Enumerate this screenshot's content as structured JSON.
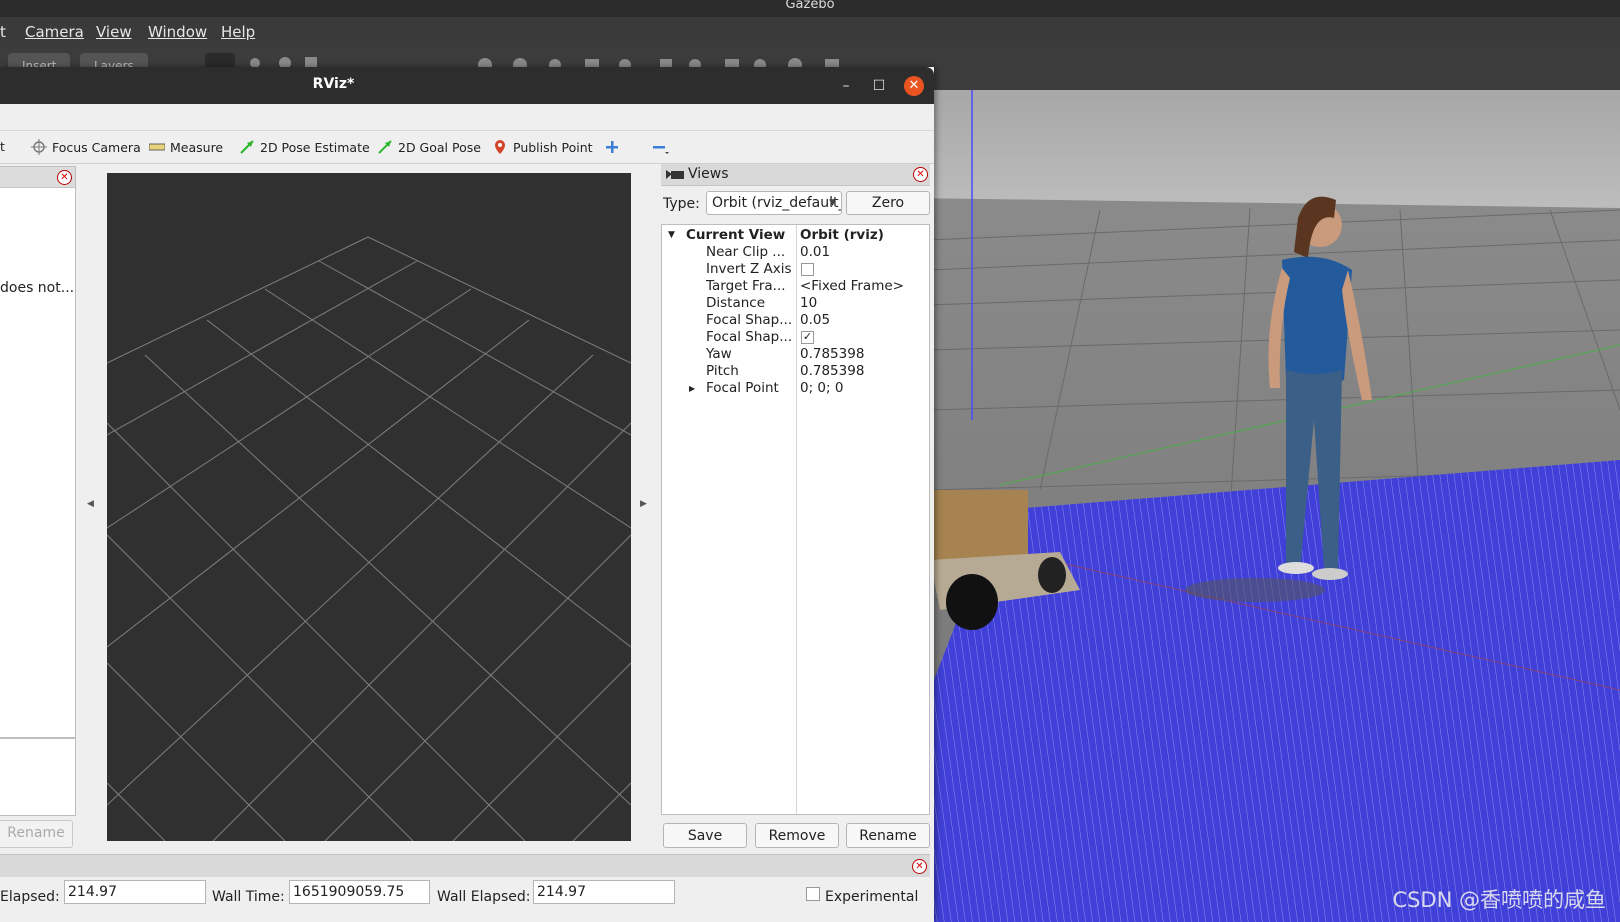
{
  "gazebo": {
    "title": "Gazebo",
    "menu": [
      {
        "label": "Edit",
        "shown": "t"
      },
      {
        "label": "Camera",
        "shown": "Camera"
      },
      {
        "label": "View",
        "shown": "View"
      },
      {
        "label": "Window",
        "shown": "Window"
      },
      {
        "label": "Help",
        "shown": "Help"
      }
    ],
    "tabs": [
      "Insert",
      "Layers"
    ]
  },
  "rviz": {
    "title": "RViz*",
    "toolbar": {
      "interact_label": "t",
      "focus_camera": "Focus Camera",
      "measure": "Measure",
      "pose_estimate": "2D Pose Estimate",
      "goal_pose": "2D Goal Pose",
      "publish_point": "Publish Point"
    },
    "displays": {
      "warning_text": "does not..."
    },
    "left_rename": "Rename",
    "views": {
      "panel_title": "Views",
      "type_label": "Type:",
      "type_value": "Orbit (rviz_default_plugins)",
      "zero_label": "Zero",
      "tree": {
        "header_key": "Current View",
        "header_val": "Orbit (rviz)",
        "near_clip_key": "Near Clip ...",
        "near_clip_val": "0.01",
        "invert_z_key": "Invert Z Axis",
        "invert_z_checked": false,
        "target_frame_key": "Target Fra...",
        "target_frame_val": "<Fixed Frame>",
        "distance_key": "Distance",
        "distance_val": "10",
        "focal_size_key": "Focal Shap...",
        "focal_size_val": "0.05",
        "focal_fixed_key": "Focal Shap...",
        "focal_fixed_checked": true,
        "yaw_key": "Yaw",
        "yaw_val": "0.785398",
        "pitch_key": "Pitch",
        "pitch_val": "0.785398",
        "focal_point_key": "Focal Point",
        "focal_point_val": "0; 0; 0"
      },
      "save": "Save",
      "remove": "Remove",
      "rename": "Rename"
    },
    "time": {
      "ros_elapsed_label": "Elapsed:",
      "ros_elapsed_value": "214.97",
      "wall_time_label": "Wall Time:",
      "wall_time_value": "1651909059.75",
      "wall_elapsed_label": "Wall Elapsed:",
      "wall_elapsed_value": "214.97",
      "experimental_label": "Experimental"
    }
  },
  "watermark": "CSDN @香喷喷的咸鱼",
  "colors": {
    "titlebar": "#2d2d2d",
    "close": "#e95420",
    "viewport": "#303030",
    "grid": "#9a9a9a",
    "laser": "#3f3fe0"
  }
}
